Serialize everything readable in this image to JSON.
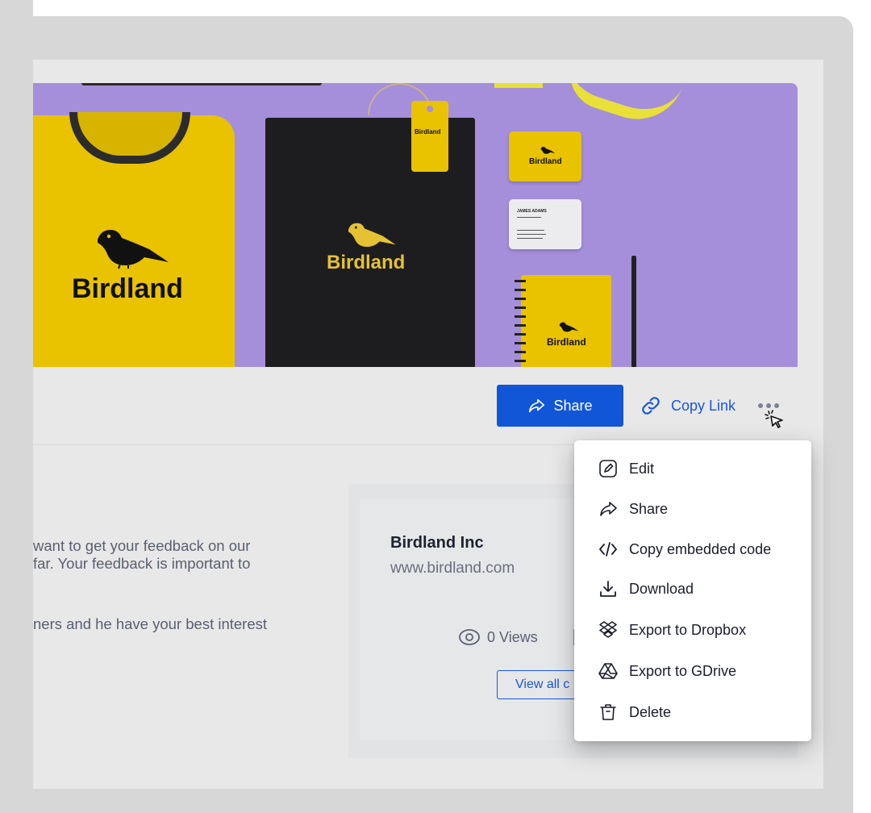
{
  "hero": {
    "shirt_brand": "Birdland",
    "notebook_brand": "Birdland",
    "tag_brand": "Birdland",
    "card_brand": "Birdland",
    "pad_brand": "Birdland",
    "card_name": "JAMES ADAMS"
  },
  "actions": {
    "share_label": "Share",
    "copy_link_label": "Copy Link"
  },
  "description": {
    "line1": "want to get  your feedback on our",
    "line2": "far. Your feedback is important to",
    "line3": "ners and he have your best interest"
  },
  "company": {
    "name": "Birdland Inc",
    "url": "www.birdland.com",
    "views": "0 Views",
    "view_all": "View all c"
  },
  "menu": {
    "items": [
      {
        "label": "Edit",
        "icon": "edit-icon"
      },
      {
        "label": "Share",
        "icon": "share-icon"
      },
      {
        "label": "Copy embedded code",
        "icon": "code-icon"
      },
      {
        "label": "Download",
        "icon": "download-icon"
      },
      {
        "label": "Export to Dropbox",
        "icon": "dropbox-icon"
      },
      {
        "label": "Export to GDrive",
        "icon": "gdrive-icon"
      },
      {
        "label": "Delete",
        "icon": "trash-icon"
      }
    ]
  },
  "colors": {
    "accent": "#1256d8",
    "link": "#1a56d6",
    "brand_yellow": "#e9c200",
    "hero_bg": "#a58fda"
  }
}
